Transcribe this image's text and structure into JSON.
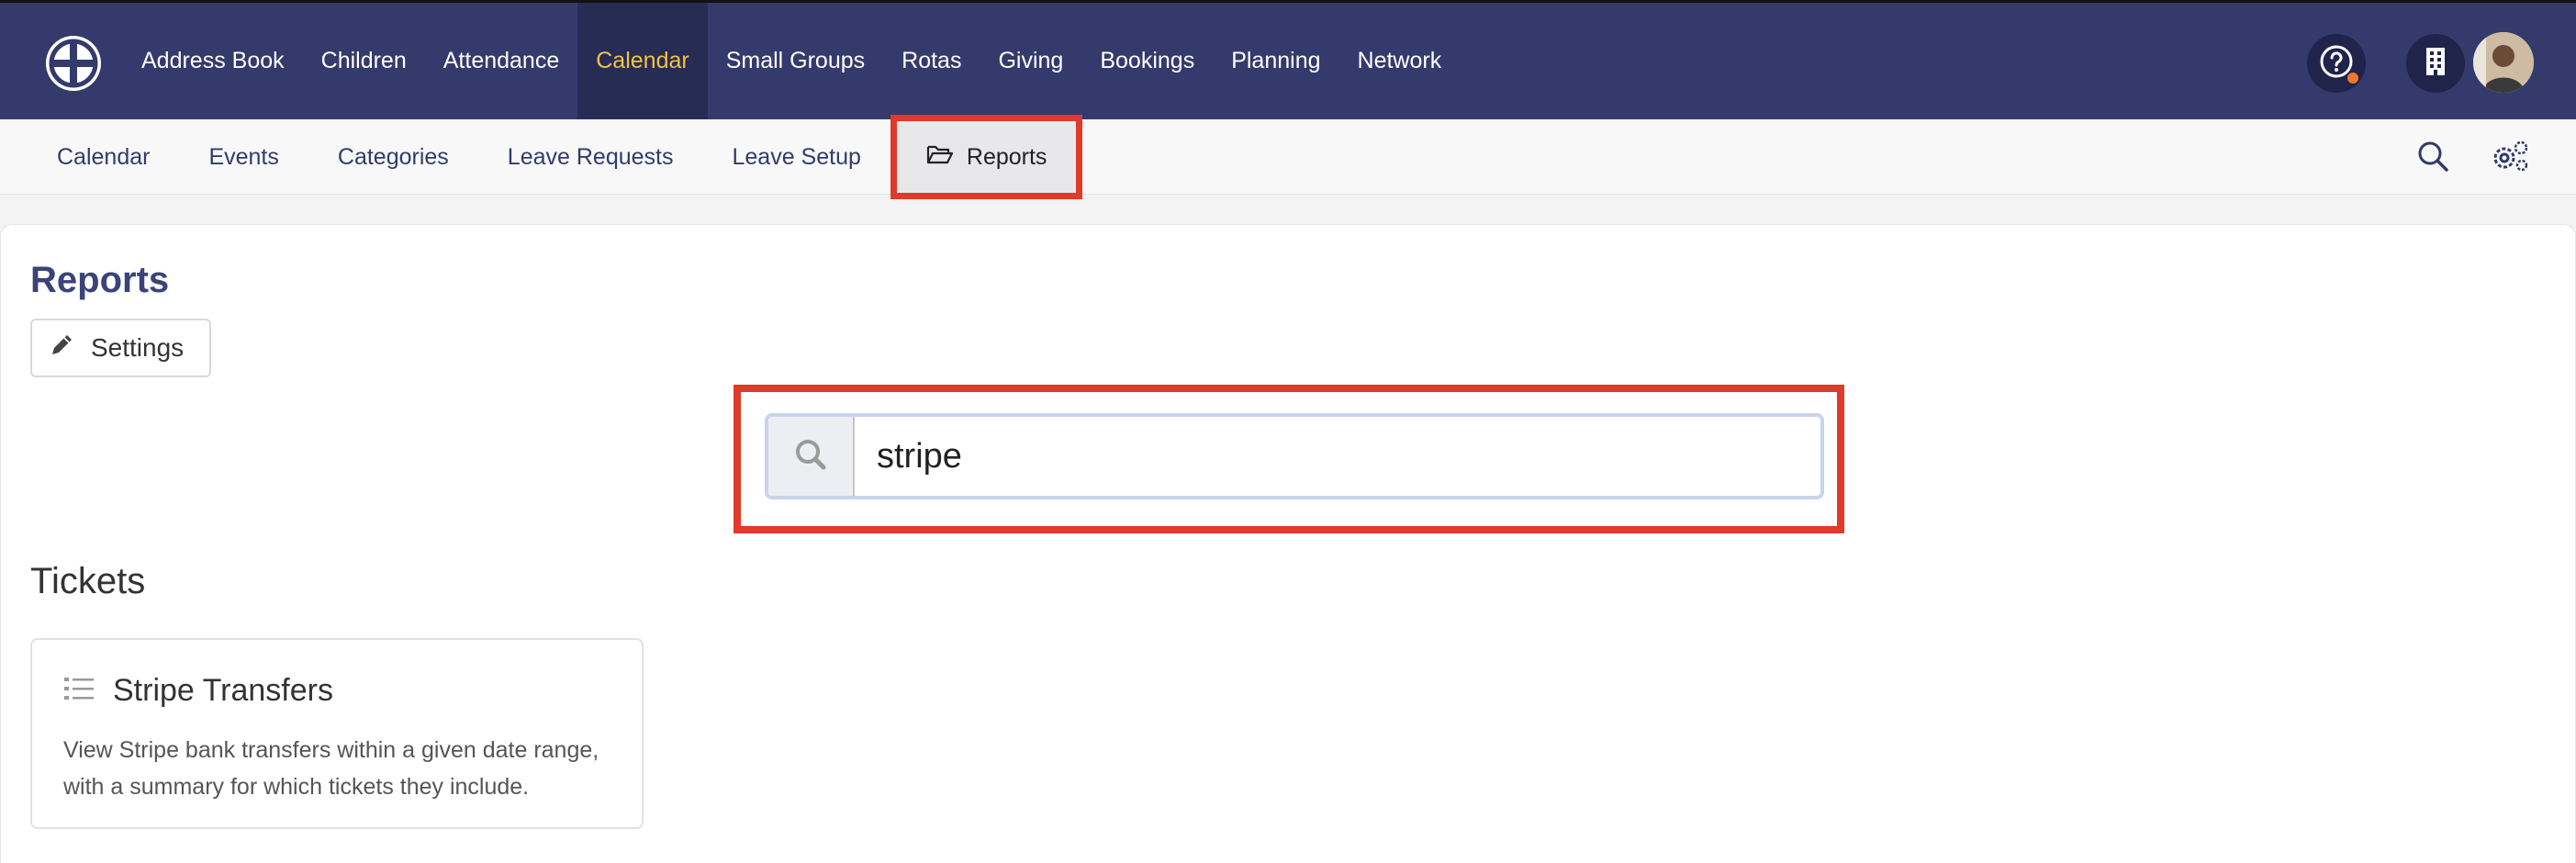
{
  "nav": {
    "items": [
      {
        "label": "Address Book"
      },
      {
        "label": "Children"
      },
      {
        "label": "Attendance"
      },
      {
        "label": "Calendar"
      },
      {
        "label": "Small Groups"
      },
      {
        "label": "Rotas"
      },
      {
        "label": "Giving"
      },
      {
        "label": "Bookings"
      },
      {
        "label": "Planning"
      },
      {
        "label": "Network"
      }
    ],
    "active": "Calendar"
  },
  "subnav": {
    "items": [
      {
        "label": "Calendar"
      },
      {
        "label": "Events"
      },
      {
        "label": "Categories"
      },
      {
        "label": "Leave Requests"
      },
      {
        "label": "Leave Setup"
      },
      {
        "label": "Reports"
      }
    ],
    "active": "Reports"
  },
  "page": {
    "title": "Reports",
    "settings_label": "Settings"
  },
  "search": {
    "value": "stripe"
  },
  "sections": [
    {
      "title": "Tickets",
      "cards": [
        {
          "title": "Stripe Transfers",
          "description": "View Stripe bank transfers within a given date range, with a summary for which tickets they include."
        }
      ]
    }
  ],
  "colors": {
    "topbar": "#343a6b",
    "active_nav_text": "#f3c245",
    "highlight": "#e03a2a",
    "title": "#3b4379"
  },
  "icons": {
    "logo": "church-cross-logo",
    "help": "help-circle-icon",
    "org": "building-icon",
    "search": "search-icon",
    "settings": "gears-icon",
    "folder": "folder-open-icon",
    "pencil": "pencil-icon",
    "list": "list-icon"
  }
}
